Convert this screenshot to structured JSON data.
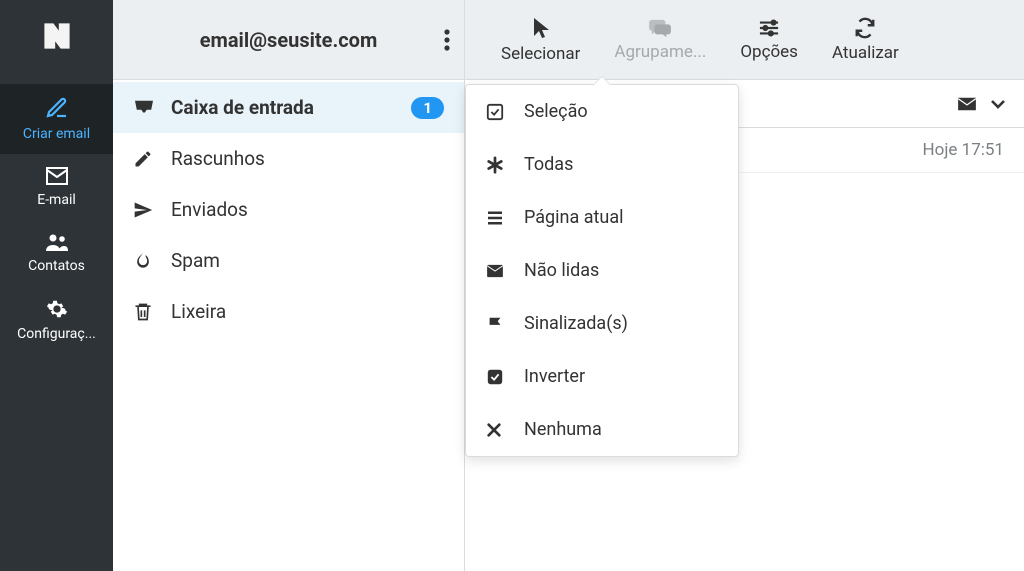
{
  "account_email": "email@seusite.com",
  "sidebar": {
    "items": [
      {
        "label": "Criar email",
        "icon": "compose"
      },
      {
        "label": "E-mail",
        "icon": "mail"
      },
      {
        "label": "Contatos",
        "icon": "contacts"
      },
      {
        "label": "Configuraç...",
        "icon": "settings"
      }
    ]
  },
  "folders": [
    {
      "name": "Caixa de entrada",
      "icon": "inbox",
      "badge": "1",
      "selected": true
    },
    {
      "name": "Rascunhos",
      "icon": "pencil"
    },
    {
      "name": "Enviados",
      "icon": "send"
    },
    {
      "name": "Spam",
      "icon": "fire"
    },
    {
      "name": "Lixeira",
      "icon": "trash"
    }
  ],
  "toolbar": [
    {
      "label": "Selecionar",
      "icon": "cursor",
      "selected": true
    },
    {
      "label": "Agrupame...",
      "icon": "chat",
      "muted": true
    },
    {
      "label": "Opções",
      "icon": "sliders"
    },
    {
      "label": "Atualizar",
      "icon": "refresh"
    }
  ],
  "dropdown": {
    "items": [
      {
        "label": "Seleção",
        "icon": "checkbox-outline"
      },
      {
        "label": "Todas",
        "icon": "asterisk"
      },
      {
        "label": "Página atual",
        "icon": "list"
      },
      {
        "label": "Não lidas",
        "icon": "envelope"
      },
      {
        "label": "Sinalizada(s)",
        "icon": "flag"
      },
      {
        "label": "Inverter",
        "icon": "checkbox-filled"
      },
      {
        "label": "Nenhuma",
        "icon": "x"
      }
    ]
  },
  "messages": [
    {
      "time": "Hoje 17:51"
    }
  ]
}
